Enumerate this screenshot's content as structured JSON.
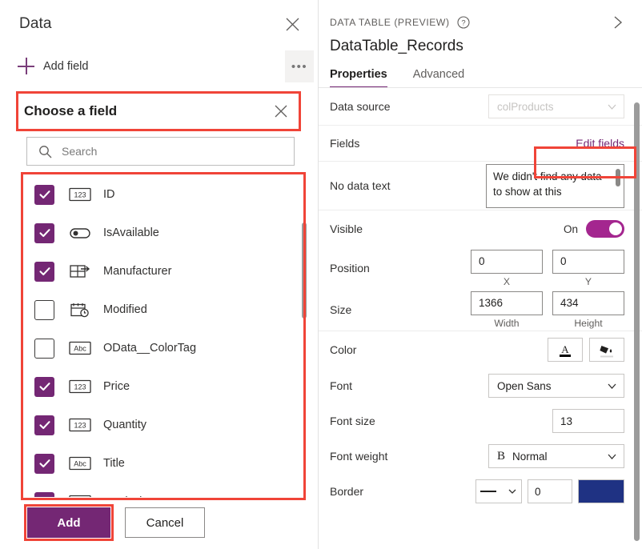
{
  "left_panel": {
    "title": "Data",
    "close_icon": "close-icon",
    "add_field_label": "Add field",
    "overflow_label": "•••",
    "chooser": {
      "title": "Choose a field",
      "close_icon": "close-icon",
      "search_placeholder": "Search",
      "search_value": "",
      "search_icon": "search-icon",
      "fields": [
        {
          "label": "ID",
          "checked": true,
          "type_icon": "number-123-icon"
        },
        {
          "label": "IsAvailable",
          "checked": true,
          "type_icon": "toggle-boolean-icon"
        },
        {
          "label": "Manufacturer",
          "checked": true,
          "type_icon": "lookup-table-icon"
        },
        {
          "label": "Modified",
          "checked": false,
          "type_icon": "calendar-clock-icon"
        },
        {
          "label": "OData__ColorTag",
          "checked": false,
          "type_icon": "text-abc-icon"
        },
        {
          "label": "Price",
          "checked": true,
          "type_icon": "number-123-icon"
        },
        {
          "label": "Quantity",
          "checked": true,
          "type_icon": "number-123-icon"
        },
        {
          "label": "Title",
          "checked": true,
          "type_icon": "text-abc-icon"
        },
        {
          "label": "TotalPrice",
          "checked": true,
          "type_icon": "number-123-icon"
        }
      ]
    },
    "add_button": "Add",
    "cancel_button": "Cancel"
  },
  "right_panel": {
    "kicker": "DATA TABLE (PREVIEW)",
    "help_icon": "help-circle-icon",
    "collapse_icon": "chevron-right-icon",
    "control_name": "DataTable_Records",
    "tabs": [
      {
        "label": "Properties",
        "active": true
      },
      {
        "label": "Advanced",
        "active": false
      }
    ],
    "properties": {
      "data_source_label": "Data source",
      "data_source_value": "colProducts",
      "fields_label": "Fields",
      "edit_fields_link": "Edit fields",
      "no_data_text_label": "No data text",
      "no_data_text_value": "We didn't find any data to show at this",
      "visible_label": "Visible",
      "visible_state": "On",
      "position_label": "Position",
      "position_x": "0",
      "position_y": "0",
      "position_x_caption": "X",
      "position_y_caption": "Y",
      "size_label": "Size",
      "size_width": "1366",
      "size_height": "434",
      "size_width_caption": "Width",
      "size_height_caption": "Height",
      "color_label": "Color",
      "color_text_icon": "font-color-a-icon",
      "color_fill_icon": "paint-bucket-icon",
      "font_label": "Font",
      "font_value": "Open Sans",
      "font_size_label": "Font size",
      "font_size_value": "13",
      "font_weight_label": "Font weight",
      "font_weight_value": "Normal",
      "font_weight_icon": "bold-b-icon",
      "border_label": "Border",
      "border_style_icon": "solid-line-icon",
      "border_thickness": "0",
      "border_color": "#1f3283"
    }
  },
  "colors": {
    "accent_purple": "#742774",
    "toggle_purple": "#a4268f",
    "highlight_red": "#f04438",
    "border_swatch_blue": "#1f3283"
  }
}
